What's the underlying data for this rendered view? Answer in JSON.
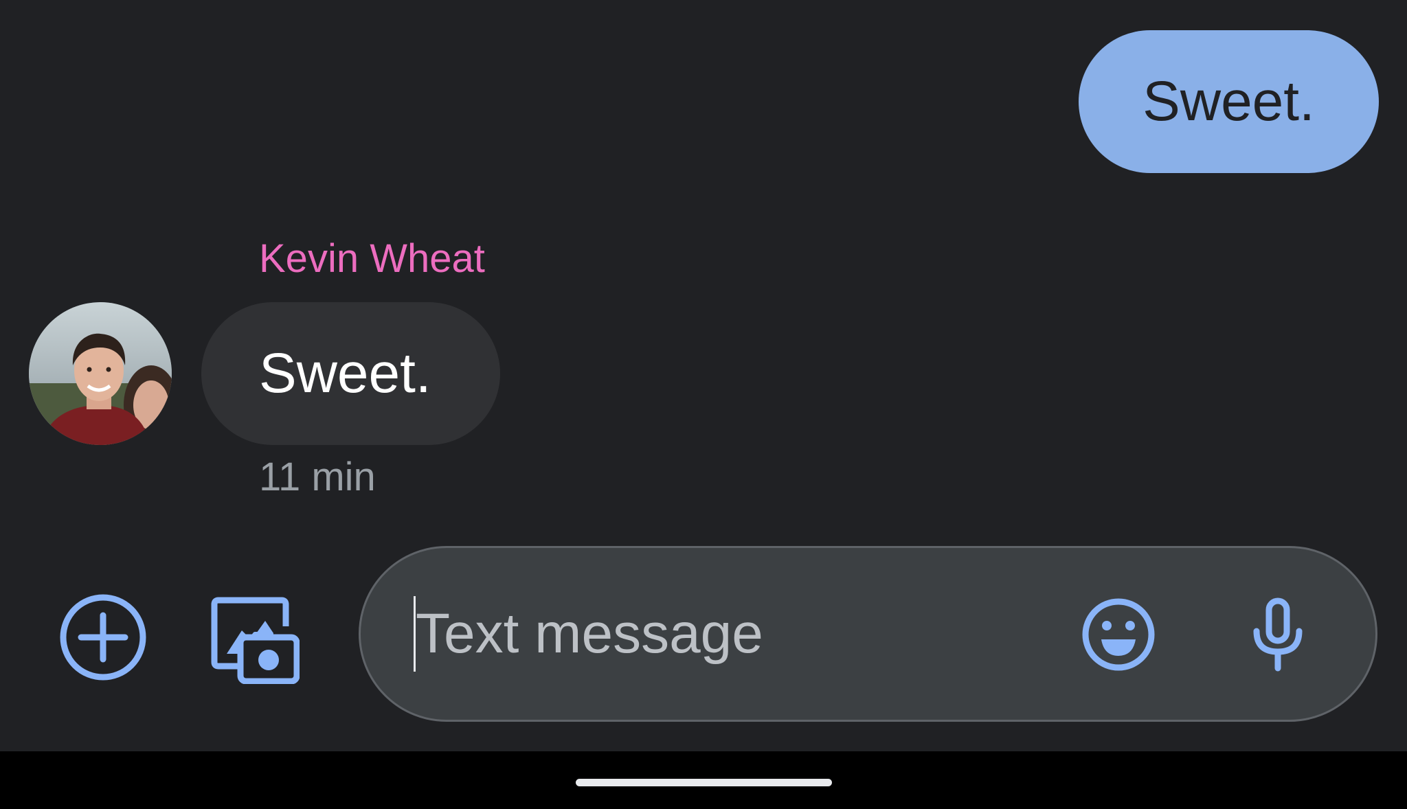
{
  "conversation": {
    "outgoing_message": {
      "text": "Sweet."
    },
    "incoming_message": {
      "sender": "Kevin Wheat",
      "text": "Sweet.",
      "timestamp": "11 min",
      "avatar": "contact-photo"
    }
  },
  "compose": {
    "placeholder": "Text message",
    "value": "",
    "icons": {
      "attach": "plus-circle-icon",
      "gallery": "gallery-camera-icon",
      "emoji": "smiley-icon",
      "voice": "microphone-icon"
    }
  },
  "colors": {
    "background": "#202124",
    "outgoing_bubble": "#8ab0e8",
    "incoming_bubble": "#303134",
    "sender_name": "#ec6dbf",
    "accent_icon": "#8ab4f8",
    "compose_field": "#3c4043"
  }
}
